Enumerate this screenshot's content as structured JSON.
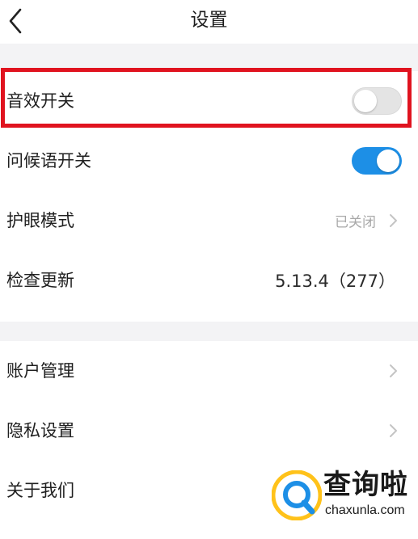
{
  "header": {
    "title": "设置",
    "back_icon": "chevron-left-icon"
  },
  "group1": {
    "rows": [
      {
        "label": "音效开关",
        "toggle": "off"
      },
      {
        "label": "问候语开关",
        "toggle": "on"
      },
      {
        "label": "护眼模式",
        "value": "已关闭",
        "icon": "chevron-right-icon"
      },
      {
        "label": "检查更新",
        "value": "5.13.4（277）"
      }
    ]
  },
  "group2": {
    "rows": [
      {
        "label": "账户管理",
        "icon": "chevron-right-icon"
      },
      {
        "label": "隐私设置",
        "icon": "chevron-right-icon"
      },
      {
        "label": "关于我们"
      }
    ]
  },
  "watermark": {
    "title": "查询啦",
    "url": "chaxunla.com"
  },
  "colors": {
    "toggle_on": "#1d8fe6",
    "toggle_off": "#e4e4e4",
    "highlight": "#e0131f",
    "background": "#f3f3f5"
  }
}
